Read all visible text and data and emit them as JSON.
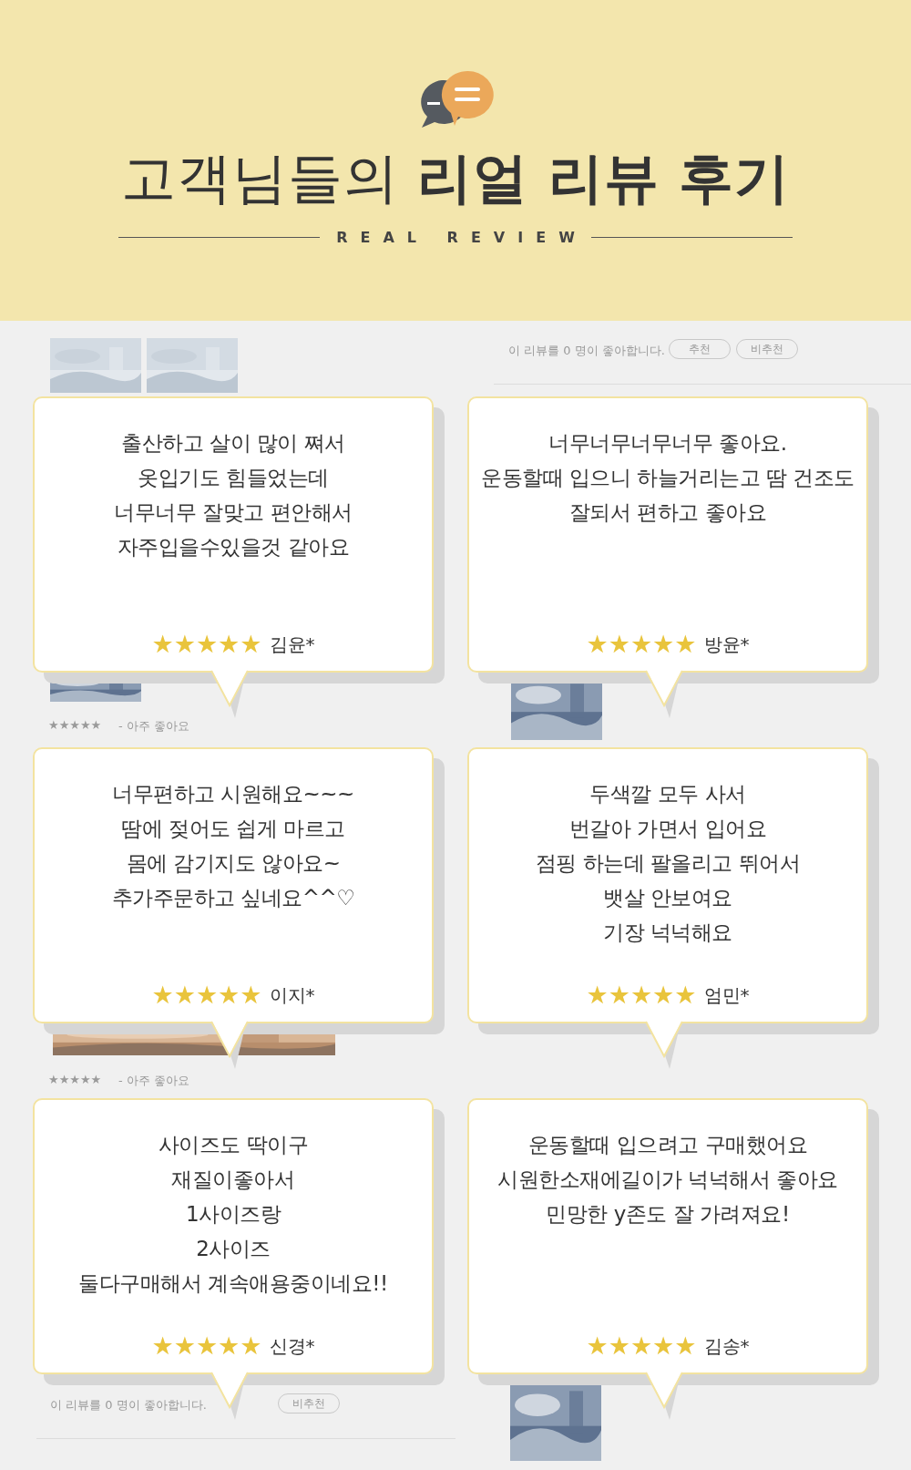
{
  "header": {
    "title": "고객님들의 **리얼 리뷰 후기**",
    "subtitle": "REAL REVIEW"
  },
  "background": {
    "top_right": {
      "likes": "이 리뷰를 0 명이 좋아합니다.",
      "buttons": [
        "추천",
        "비추천"
      ]
    },
    "ratings": [
      {
        "stars": "★★★★★",
        "comment": "- 아주 좋아요"
      },
      {
        "stars": "★★★★★",
        "comment": "- 아주 좋아요"
      }
    ],
    "bottom_left": {
      "likes": "이 리뷰를 0 명이 좋아합니다.",
      "buttons": [
        "비추천"
      ]
    }
  },
  "reviews": [
    {
      "text": "출산하고 살이 많이 쪄서\n옷입기도 힘들었는데\n너무너무 잘맞고 편안해서\n자주입을수있을것 같아요",
      "stars": 5,
      "author": "김윤*"
    },
    {
      "text": "너무너무너무너무 좋아요.\n운동할때 입으니 하늘거리는고 땀 건조도\n잘되서 편하고 좋아요",
      "stars": 5,
      "author": "방윤*"
    },
    {
      "text": "너무편하고 시원해요~~~\n땀에 젖어도 쉽게 마르고\n몸에 감기지도 않아요~\n추가주문하고 싶네요^^♡",
      "stars": 5,
      "author": "이지*"
    },
    {
      "text": "두색깔 모두 사서\n번갈아 가면서 입어요\n점핑 하는데 팔올리고 뛰어서\n뱃살 안보여요\n기장 넉넉해요",
      "stars": 5,
      "author": "엄민*"
    },
    {
      "text": "사이즈도 딱이구\n재질이좋아서\n1사이즈랑\n2사이즈\n둘다구매해서 계속애용중이네요!!",
      "stars": 5,
      "author": "신경*"
    },
    {
      "text": "운동할때 입으려고 구매했어요\n시원한소재에길이가 넉넉해서 좋아요\n민망한 y존도 잘 가려져요!",
      "stars": 5,
      "author": "김송*"
    }
  ]
}
